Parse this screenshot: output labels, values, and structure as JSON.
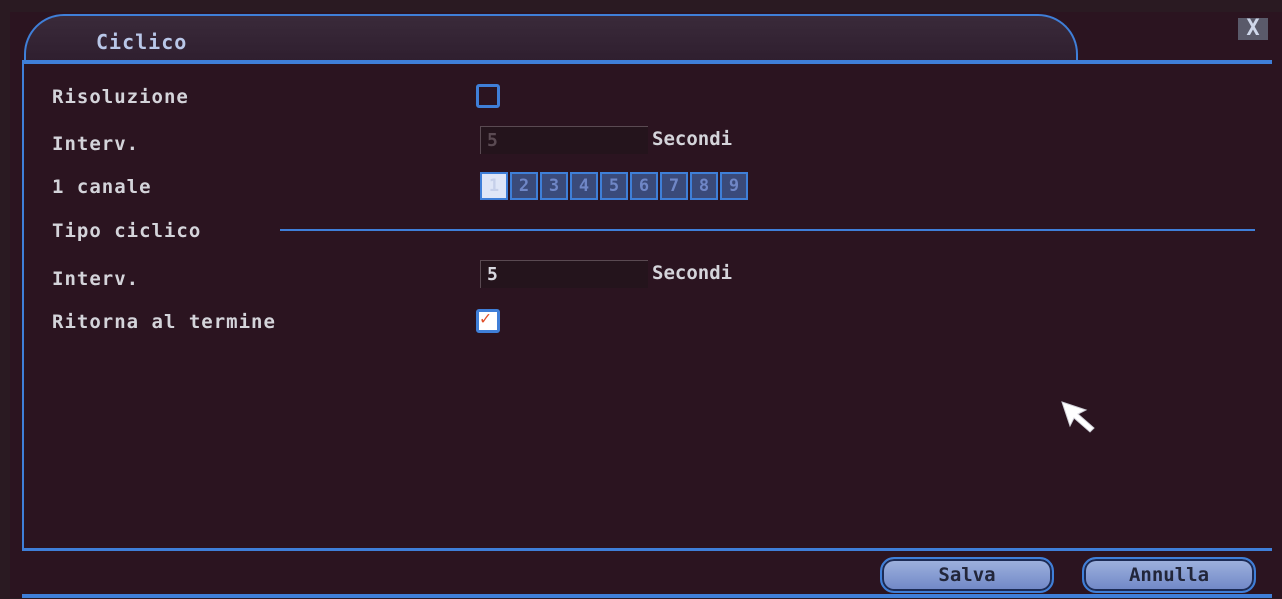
{
  "window": {
    "title": "Ciclico",
    "close_label": "X"
  },
  "form": {
    "risoluzione": {
      "label": "Risoluzione",
      "checked": false
    },
    "interv1": {
      "label": "Interv.",
      "value": "5",
      "unit": "Secondi",
      "disabled": true
    },
    "canale": {
      "label": "1 canale",
      "channels": [
        "1",
        "2",
        "3",
        "4",
        "5",
        "6",
        "7",
        "8",
        "9"
      ],
      "selected": "1"
    },
    "section": {
      "label": "Tipo ciclico"
    },
    "interv2": {
      "label": "Interv.",
      "value": "5",
      "unit": "Secondi"
    },
    "ritorna": {
      "label": "Ritorna al termine",
      "checked": true
    }
  },
  "buttons": {
    "save": "Salva",
    "cancel": "Annulla"
  },
  "colors": {
    "accent": "#3f7fd8",
    "background": "#2b1420",
    "check_mark": "#e0502a"
  },
  "icons": {
    "close": "close-icon",
    "check": "check-icon",
    "cursor": "pointer-cursor-icon"
  }
}
